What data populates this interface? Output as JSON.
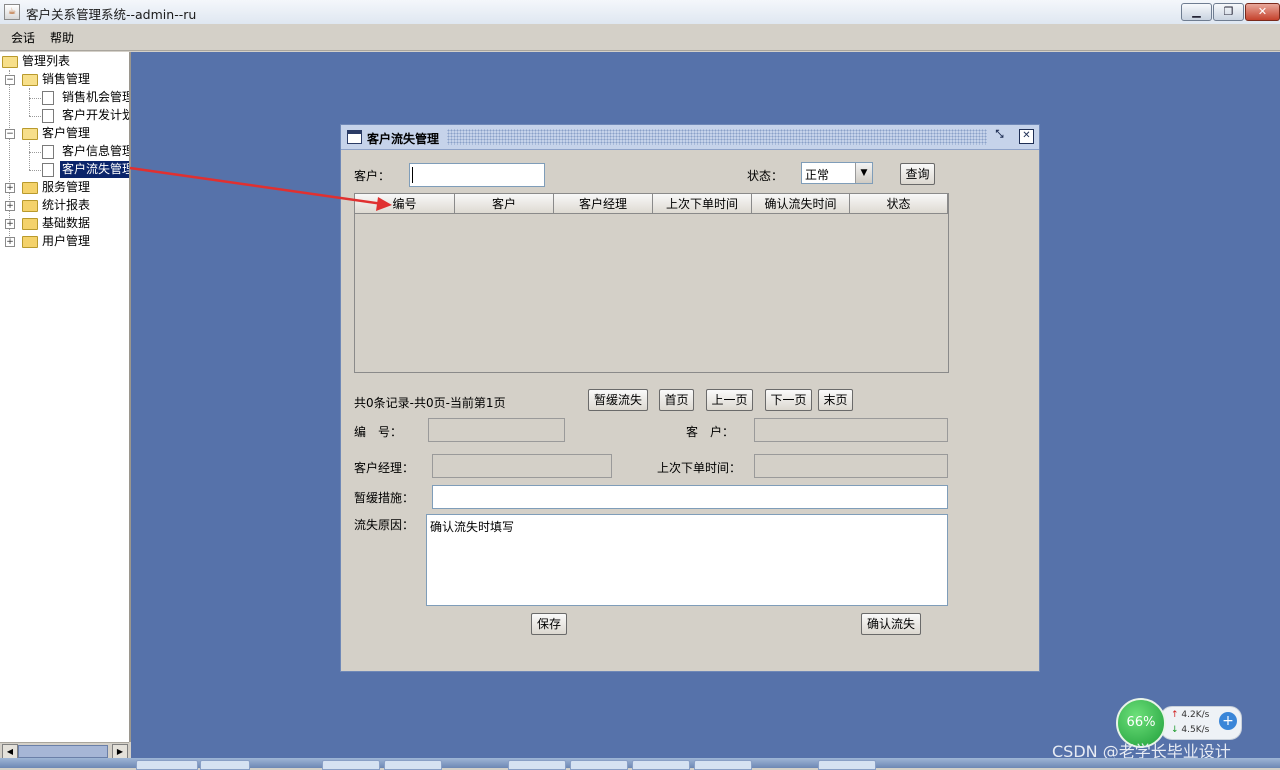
{
  "window": {
    "title": "客户关系管理系统--admin--ru",
    "minimize_icon": "minimize-icon",
    "maximize_icon": "restore-icon",
    "close_icon": "close-icon"
  },
  "menubar": {
    "items": [
      {
        "label": "会话"
      },
      {
        "label": "帮助"
      }
    ]
  },
  "tree": {
    "root": "管理列表",
    "nodes": [
      {
        "label": "销售管理"
      },
      {
        "label": "销售机会管理"
      },
      {
        "label": "客户开发计划"
      },
      {
        "label": "客户管理"
      },
      {
        "label": "客户信息管理"
      },
      {
        "label": "客户流失管理"
      },
      {
        "label": "服务管理"
      },
      {
        "label": "统计报表"
      },
      {
        "label": "基础数据"
      },
      {
        "label": "用户管理"
      }
    ]
  },
  "frame": {
    "title": "客户流失管理",
    "search": {
      "customer_label": "客户：",
      "customer_value": "",
      "status_label": "状态：",
      "status_value": "正常",
      "query_button": "查询"
    },
    "table": {
      "columns": [
        "编号",
        "客户",
        "客户经理",
        "上次下单时间",
        "确认流失时间",
        "状态"
      ],
      "rows": []
    },
    "pager": {
      "summary": "共0条记录-共0页-当前第1页",
      "defer_button": "暂缓流失",
      "first_button": "首页",
      "prev_button": "上一页",
      "next_button": "下一页",
      "last_button": "末页"
    },
    "form": {
      "id_label": "编　号：",
      "id_value": "",
      "customer_label": "客　户：",
      "customer_value": "",
      "manager_label": "客户经理：",
      "manager_value": "",
      "last_order_label": "上次下单时间：",
      "last_order_value": "",
      "measure_label": "暂缓措施：",
      "measure_value": "",
      "reason_label": "流失原因：",
      "reason_value": "确认流失时填写",
      "save_button": "保存",
      "confirm_button": "确认流失"
    }
  },
  "network": {
    "percent": "66%",
    "up": "4.2K/s",
    "down": "4.5K/s"
  },
  "watermark": "CSDN @老学长毕业设计"
}
